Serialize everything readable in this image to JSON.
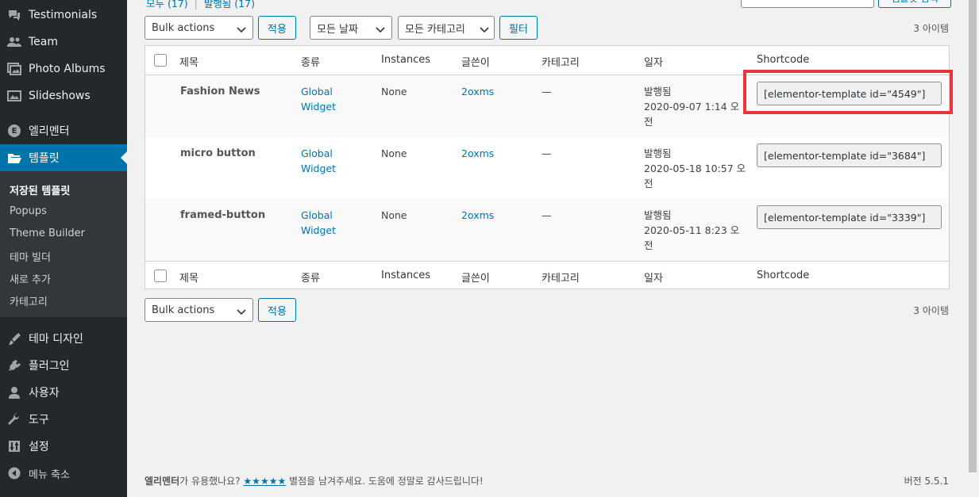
{
  "sidebar": {
    "items": [
      {
        "label": "Testimonials",
        "icon": "chat-bubble-icon"
      },
      {
        "label": "Team",
        "icon": "people-icon"
      },
      {
        "label": "Photo Albums",
        "icon": "gallery-icon"
      },
      {
        "label": "Slideshows",
        "icon": "slides-icon"
      },
      {
        "label": "엘리멘터",
        "icon": "elementor-icon"
      },
      {
        "label": "템플릿",
        "icon": "folder-icon"
      },
      {
        "label": "테마 디자인",
        "icon": "brush-icon"
      },
      {
        "label": "플러그인",
        "icon": "plug-icon"
      },
      {
        "label": "사용자",
        "icon": "user-icon"
      },
      {
        "label": "도구",
        "icon": "wrench-icon"
      },
      {
        "label": "설정",
        "icon": "settings-icon"
      },
      {
        "label": "메뉴 축소",
        "icon": "collapse-icon"
      }
    ],
    "submenu": [
      "저장된 템플릿",
      "Popups",
      "Theme Builder",
      "테마 빌더",
      "새로 추가",
      "카테고리"
    ],
    "active_color": "#0073aa"
  },
  "top_partial": {
    "all": "모두 (17)",
    "separator": "|",
    "published": "발행됨 (17)",
    "search_button": "템플릿 검색"
  },
  "filters": {
    "bulk_actions": "Bulk actions",
    "apply": "적용",
    "all_dates": "모든 날짜",
    "all_categories": "모든 카테고리",
    "filter": "필터",
    "count": "3 아이템"
  },
  "table": {
    "columns": [
      "제목",
      "종류",
      "Instances",
      "글쓴이",
      "카테고리",
      "일자",
      "Shortcode"
    ],
    "rows": [
      {
        "title": "Fashion News",
        "type_line1": "Global",
        "type_line2": "Widget",
        "instances": "None",
        "author": "2oxms",
        "category": "—",
        "status": "발행됨",
        "date_line1": "2020-09-07 1:14 오",
        "date_line2": "전",
        "shortcode": "[elementor-template id=\"4549\"]"
      },
      {
        "title": "micro button",
        "type_line1": "Global",
        "type_line2": "Widget",
        "instances": "None",
        "author": "2oxms",
        "category": "—",
        "status": "발행됨",
        "date_line1": "2020-05-18 10:57 오",
        "date_line2": "전",
        "shortcode": "[elementor-template id=\"3684\"]"
      },
      {
        "title": "framed-button",
        "type_line1": "Global",
        "type_line2": "Widget",
        "instances": "None",
        "author": "2oxms",
        "category": "—",
        "status": "발행됨",
        "date_line1": "2020-05-11 8:23 오",
        "date_line2": "전",
        "shortcode": "[elementor-template id=\"3339\"]"
      }
    ]
  },
  "footer": {
    "brand": "엘리멘터",
    "text_before": "가 유용했나요? ",
    "stars": "★★★★★",
    "text_after": " 별점을 남겨주세요. 도움에 정말로 감사드립니다!",
    "version": "버전 5.5.1"
  },
  "colors": {
    "highlight": "#e8353b",
    "link": "#0073aa"
  }
}
